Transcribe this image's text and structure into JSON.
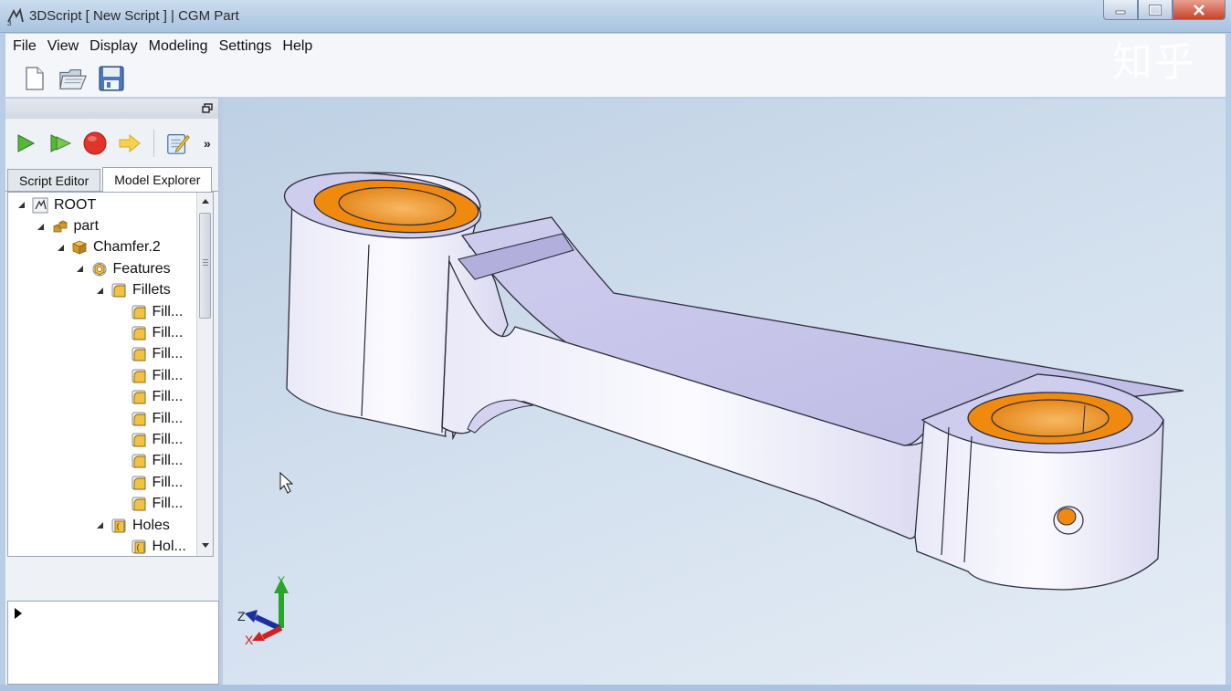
{
  "window": {
    "title": "3DScript [ New Script ] | CGM Part",
    "logo_icon": "ds-logo-icon",
    "controls": [
      "minimize-icon",
      "maximize-icon",
      "close-icon"
    ]
  },
  "menu": [
    "File",
    "View",
    "Display",
    "Modeling",
    "Settings",
    "Help"
  ],
  "toolbar": [
    "new-file-icon",
    "open-folder-icon",
    "save-disk-icon"
  ],
  "watermark": "知乎",
  "script_toolbar": [
    "run-icon",
    "run-step-icon",
    "stop-icon",
    "next-arrow-icon",
    "edit-script-icon",
    "more-chevron-icon"
  ],
  "more_label": "»",
  "tabs": [
    {
      "label": "Script Editor",
      "active": false
    },
    {
      "label": "Model Explorer",
      "active": true
    }
  ],
  "tree": [
    {
      "label": "ROOT",
      "level": 0,
      "expanded": true,
      "icon": "root-icon"
    },
    {
      "label": "part",
      "level": 1,
      "expanded": true,
      "icon": "part-icon"
    },
    {
      "label": "Chamfer.2",
      "level": 2,
      "expanded": true,
      "icon": "body-cube-icon"
    },
    {
      "label": "Features",
      "level": 3,
      "expanded": true,
      "icon": "features-icon"
    },
    {
      "label": "Fillets",
      "level": 4,
      "expanded": true,
      "icon": "fillet-icon"
    },
    {
      "label": "Fill...",
      "level": 5,
      "icon": "fillet-icon"
    },
    {
      "label": "Fill...",
      "level": 5,
      "icon": "fillet-icon"
    },
    {
      "label": "Fill...",
      "level": 5,
      "icon": "fillet-icon"
    },
    {
      "label": "Fill...",
      "level": 5,
      "icon": "fillet-icon"
    },
    {
      "label": "Fill...",
      "level": 5,
      "icon": "fillet-icon"
    },
    {
      "label": "Fill...",
      "level": 5,
      "icon": "fillet-icon"
    },
    {
      "label": "Fill...",
      "level": 5,
      "icon": "fillet-icon"
    },
    {
      "label": "Fill...",
      "level": 5,
      "icon": "fillet-icon"
    },
    {
      "label": "Fill...",
      "level": 5,
      "icon": "fillet-icon"
    },
    {
      "label": "Fill...",
      "level": 5,
      "icon": "fillet-icon"
    },
    {
      "label": "Holes",
      "level": 4,
      "expanded": true,
      "icon": "hole-icon"
    },
    {
      "label": "Hol...",
      "level": 5,
      "icon": "hole-icon"
    }
  ],
  "axes": {
    "y": "Y",
    "z": "Z",
    "x": "X"
  },
  "colors": {
    "bearing": "#f08a0f",
    "bore": "#f4a040",
    "part_face": "#eeeefa",
    "part_top": "#c7c4ea",
    "axis_y": "#27a629",
    "axis_z": "#1c2f9e",
    "axis_x": "#d02020"
  }
}
